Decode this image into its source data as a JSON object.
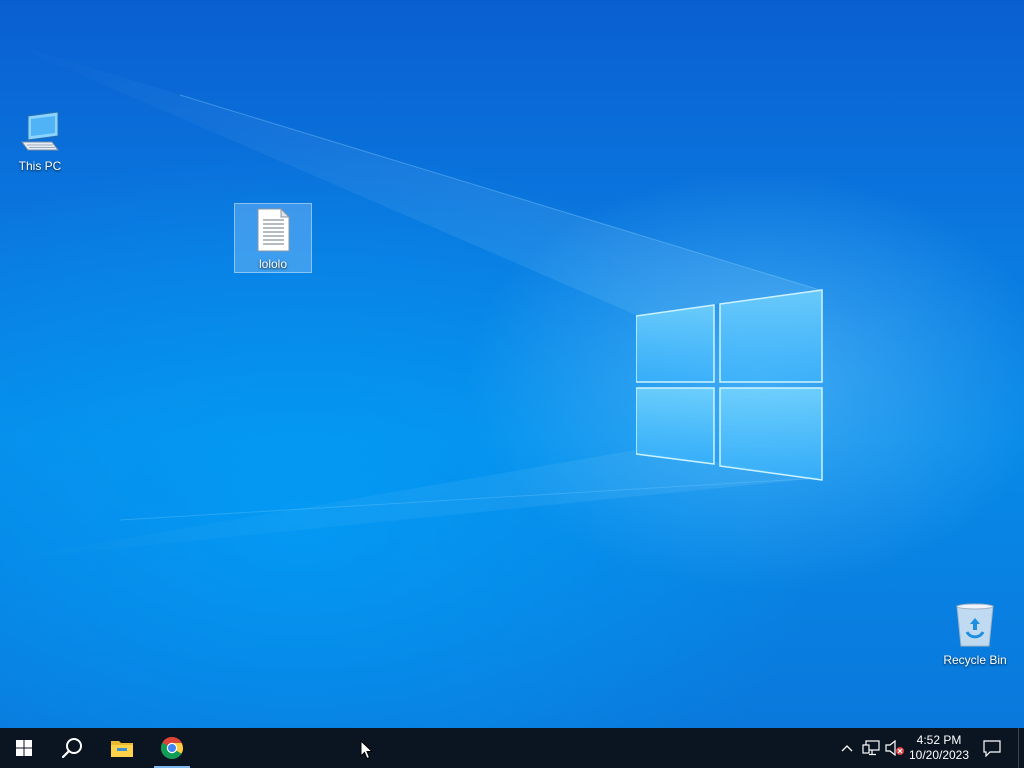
{
  "desktop": {
    "icons": [
      {
        "label": "This PC",
        "icon": "computer-icon"
      },
      {
        "label": "lololo",
        "icon": "text-file-icon"
      },
      {
        "label": "Recycle Bin",
        "icon": "recycle-bin-icon"
      }
    ]
  },
  "taskbar": {
    "items": [
      {
        "icon": "windows-start-icon"
      },
      {
        "icon": "search-icon"
      },
      {
        "icon": "file-explorer-icon"
      },
      {
        "icon": "chrome-icon",
        "active": true
      }
    ],
    "tray": {
      "icons": [
        "chevron-up-icon",
        "network-icon",
        "volume-muted-icon"
      ],
      "time": "4:52 PM",
      "date": "10/20/2023"
    }
  },
  "colors": {
    "taskbar": "#0b1522",
    "desktop_accent": "#0a78dc"
  }
}
